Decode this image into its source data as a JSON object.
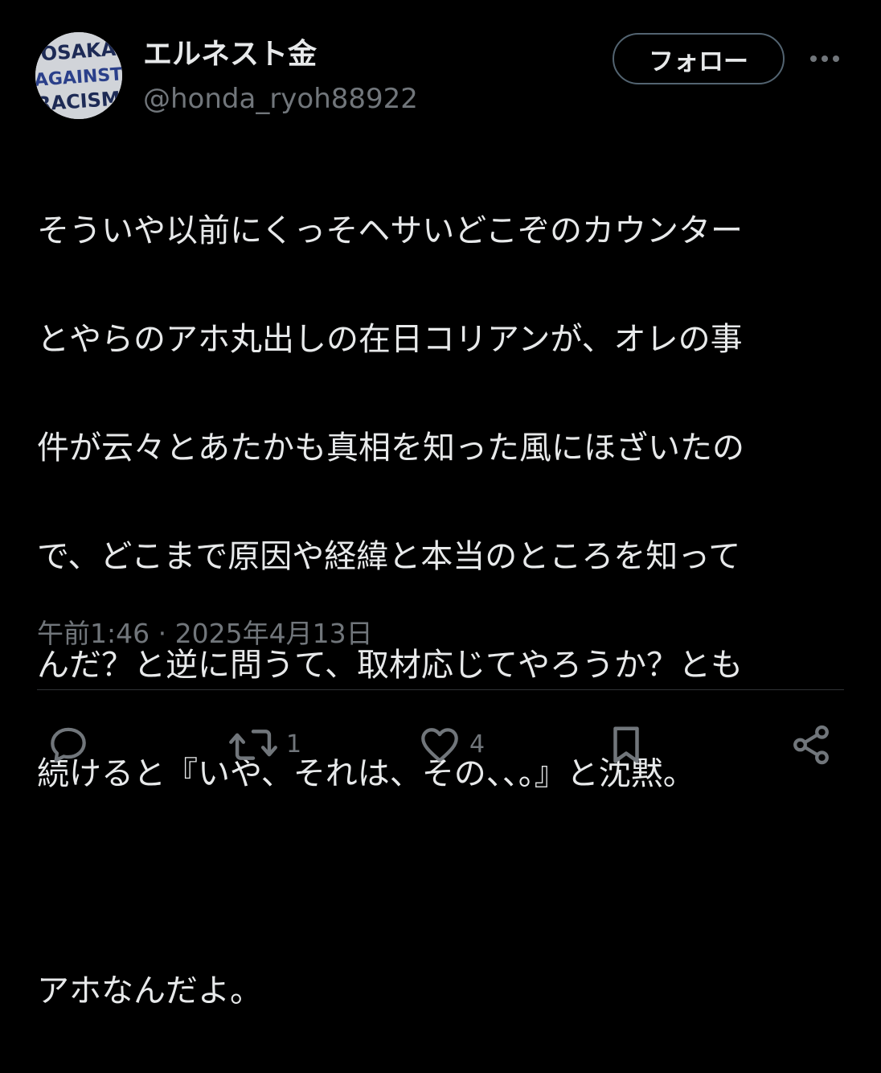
{
  "author": {
    "display_name": "エルネスト金",
    "handle": "@honda_ryoh88922",
    "avatar_text": [
      "OSAKA",
      "AGAINST",
      "RACISM"
    ]
  },
  "follow_label": "フォロー",
  "tweet": {
    "lines": [
      "そういや以前にくっそヘサいどこぞのカウンター",
      "とやらのアホ丸出しの在日コリアンが、オレの事",
      "件が云々とあたかも真相を知った風にほざいたの",
      "で、どこまで原因や経緯と本当のところを知って",
      "んだ？と逆に問うて、取材応じてやろうか？とも",
      "続けると『いや、それは、その、、。』と沈黙。",
      "",
      "アホなんだよ。"
    ]
  },
  "meta": {
    "time": "午前1:46",
    "separator": " · ",
    "date": "2025年4月13日"
  },
  "actions": {
    "reply_icon": "reply-icon",
    "retweet_icon": "retweet-icon",
    "retweet_count": "1",
    "like_icon": "heart-icon",
    "like_count": "4",
    "bookmark_icon": "bookmark-icon",
    "share_icon": "share-icon"
  },
  "colors": {
    "background": "#000000",
    "text_primary": "#e7e9ea",
    "text_secondary": "#71767b",
    "border": "#536471",
    "divider": "#2f3336"
  }
}
